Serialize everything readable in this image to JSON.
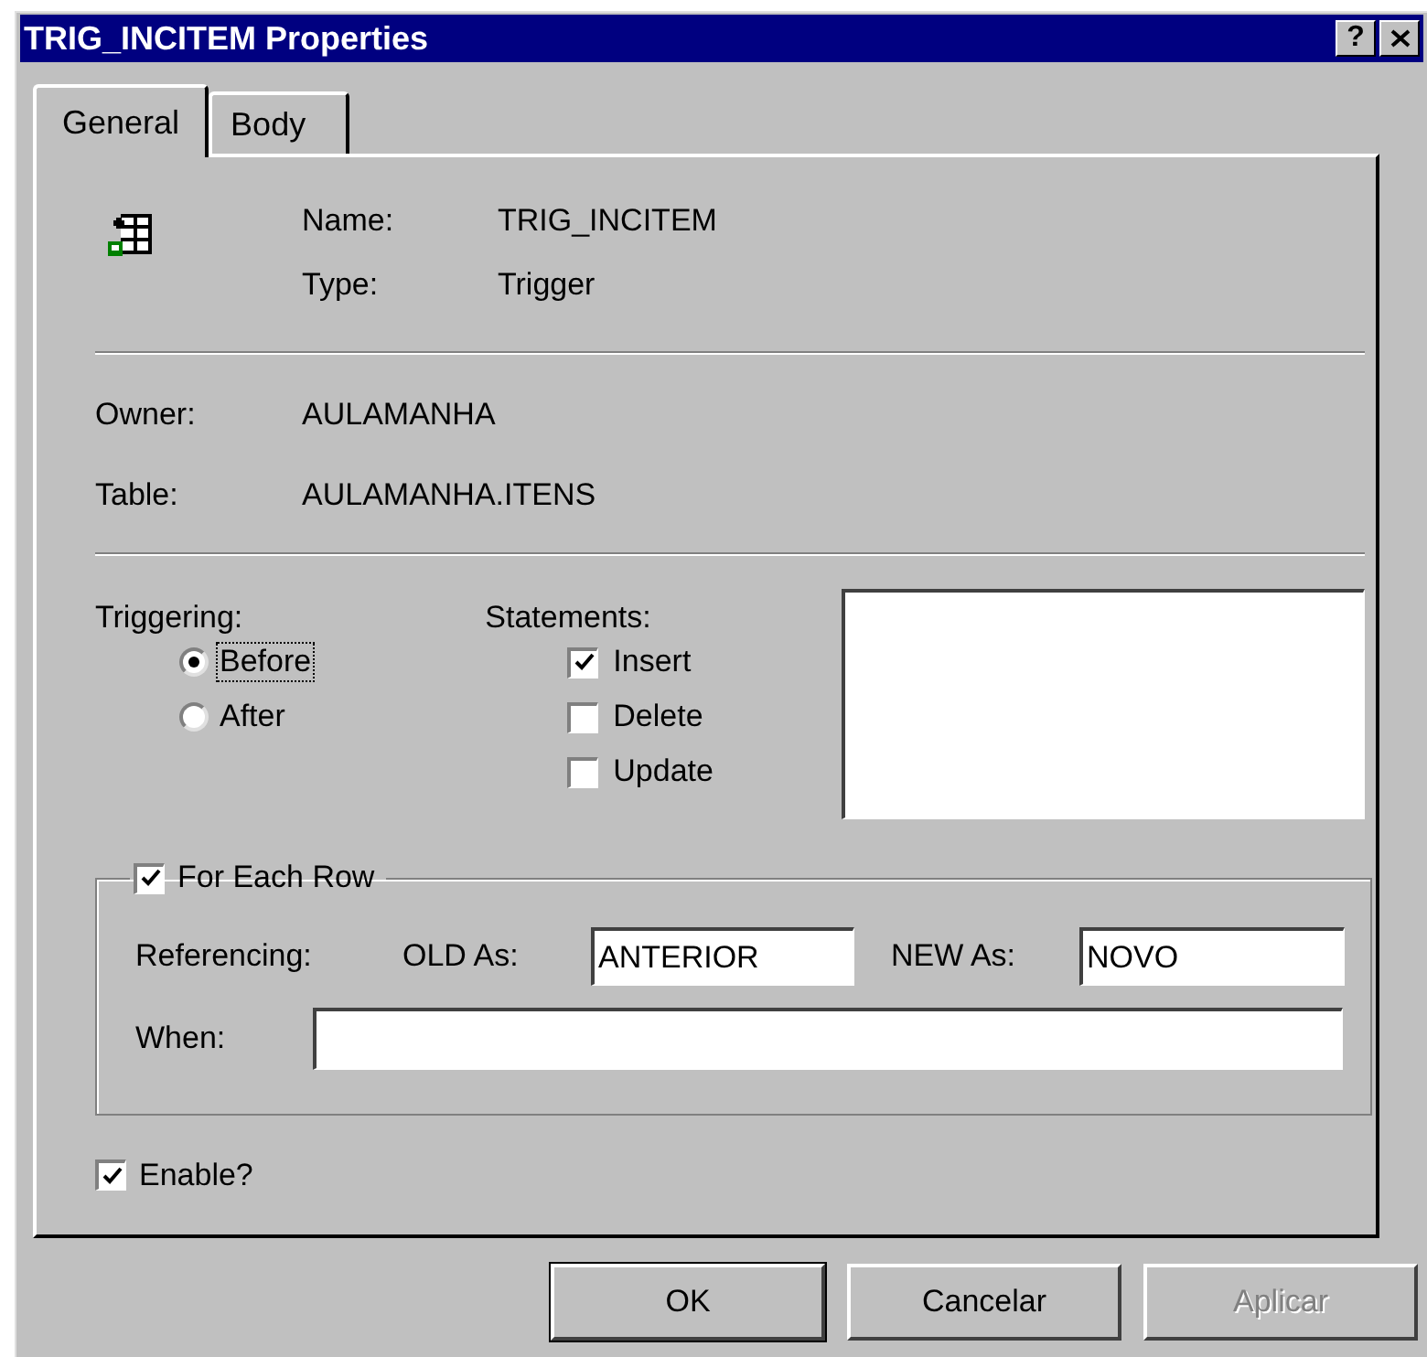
{
  "window": {
    "title": "TRIG_INCITEM Properties",
    "help_button": "?"
  },
  "tabs": [
    {
      "label": "General",
      "selected": true
    },
    {
      "label": "Body",
      "selected": false
    }
  ],
  "general": {
    "name_label": "Name:",
    "name_value": "TRIG_INCITEM",
    "type_label": "Type:",
    "type_value": "Trigger",
    "owner_label": "Owner:",
    "owner_value": "AULAMANHA",
    "table_label": "Table:",
    "table_value": "AULAMANHA.ITENS"
  },
  "triggering": {
    "label": "Triggering:",
    "options": [
      {
        "label": "Before",
        "selected": true,
        "focused": true
      },
      {
        "label": "After",
        "selected": false,
        "focused": false
      }
    ]
  },
  "statements": {
    "label": "Statements:",
    "items": [
      {
        "label": "Insert",
        "checked": true
      },
      {
        "label": "Delete",
        "checked": false
      },
      {
        "label": "Update",
        "checked": false
      }
    ]
  },
  "for_each_row": {
    "label": "For Each Row",
    "checked": true,
    "referencing_label": "Referencing:",
    "old_label": "OLD As:",
    "old_value": "ANTERIOR",
    "new_label": "NEW As:",
    "new_value": "NOVO",
    "when_label": "When:"
  },
  "enable": {
    "label": "Enable?",
    "checked": true
  },
  "buttons": [
    {
      "label": "OK",
      "default": true,
      "disabled": false
    },
    {
      "label": "Cancelar",
      "default": false,
      "disabled": false
    },
    {
      "label": "Aplicar",
      "default": false,
      "disabled": true
    }
  ]
}
